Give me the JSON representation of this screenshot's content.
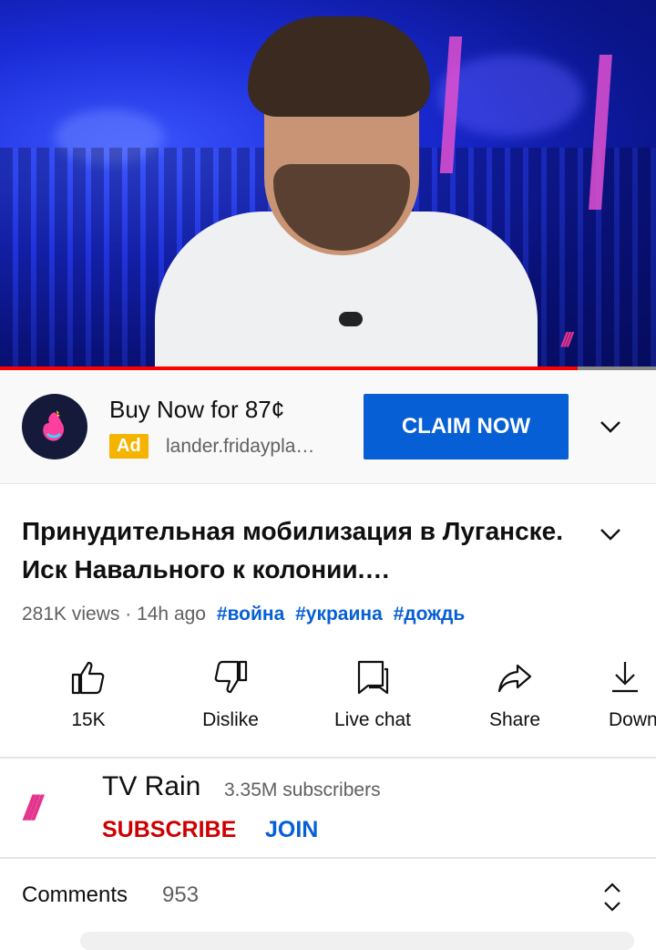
{
  "video": {
    "progress": 0.88,
    "player_icon": "tv-rain-watermark"
  },
  "ad": {
    "logo_icon": "rooster-logo-icon",
    "title": "Buy Now for 87¢",
    "badge": "Ad",
    "url": "lander.fridaypla…",
    "cta": "CLAIM NOW",
    "menu_icon": "chevron-down-icon"
  },
  "video_info": {
    "title": "Принудительная мобилизация в Луганске. Иск Навального к колонии.…",
    "views": "281K views",
    "separator": "·",
    "age": "14h ago",
    "hashtags": [
      "#война",
      "#украина",
      "#дождь"
    ],
    "expand_icon": "chevron-down-icon"
  },
  "actions": [
    {
      "label": "15K",
      "icon": "thumbs-up-icon"
    },
    {
      "label": "Dislike",
      "icon": "thumbs-down-icon"
    },
    {
      "label": "Live chat",
      "icon": "live-chat-icon"
    },
    {
      "label": "Share",
      "icon": "share-icon"
    },
    {
      "label": "Down",
      "icon": "download-icon"
    }
  ],
  "channel": {
    "logo": "///",
    "name": "TV Rain",
    "subscribers": "3.35M subscribers",
    "subscribe": "SUBSCRIBE",
    "join": "JOIN"
  },
  "comments": {
    "label": "Comments",
    "count": "953",
    "expand_icon": "unfold-icon"
  },
  "colors": {
    "accent_blue": "#065fd4",
    "subscribe_red": "#cc0000",
    "ad_badge": "#f4b400",
    "progress_red": "#ff0000",
    "channel_pink": "#e3338e"
  }
}
